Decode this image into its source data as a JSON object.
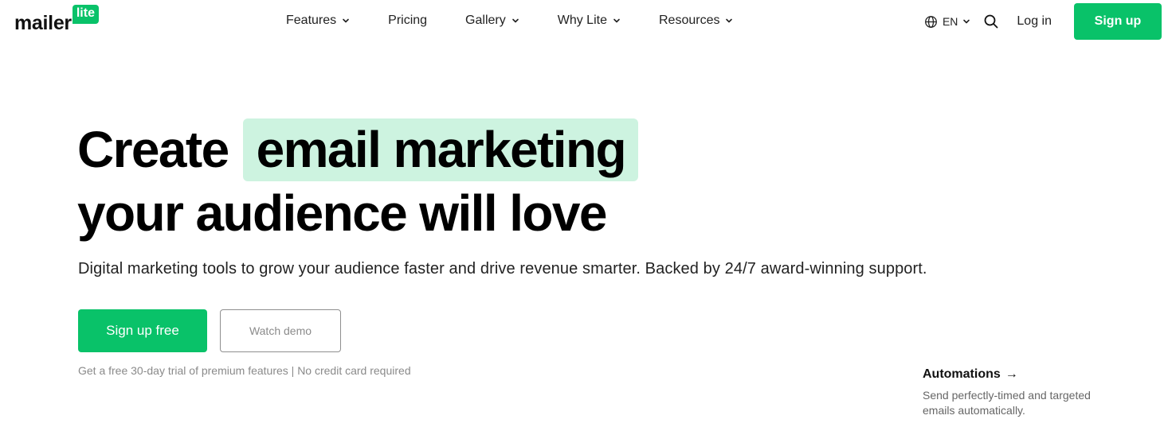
{
  "logo": {
    "word": "mailer",
    "badge": "lite"
  },
  "nav": [
    {
      "label": "Features",
      "dropdown": true
    },
    {
      "label": "Pricing",
      "dropdown": false
    },
    {
      "label": "Gallery",
      "dropdown": true
    },
    {
      "label": "Why Lite",
      "dropdown": true
    },
    {
      "label": "Resources",
      "dropdown": true
    }
  ],
  "header": {
    "language": "EN",
    "language_icon": "globe-icon",
    "search_icon": "search-icon",
    "login_label": "Log in",
    "signup_label": "Sign up"
  },
  "hero": {
    "headline_start": "Create",
    "headline_highlight": "email marketing",
    "headline_end": "your audience will love",
    "subtitle": "Digital marketing tools to grow your audience faster and drive revenue smarter. Backed by 24/7 award-winning support.",
    "primary_cta": "Sign up free",
    "secondary_cta": "Watch demo",
    "trial_note": "Get a free 30-day trial of premium features | No credit card required"
  },
  "feature": {
    "title": "Automations",
    "arrow": "→",
    "description": "Send perfectly-timed and targeted emails automatically."
  },
  "colors": {
    "brand_green": "#09c269",
    "highlight_bg": "#cdf3e0"
  }
}
